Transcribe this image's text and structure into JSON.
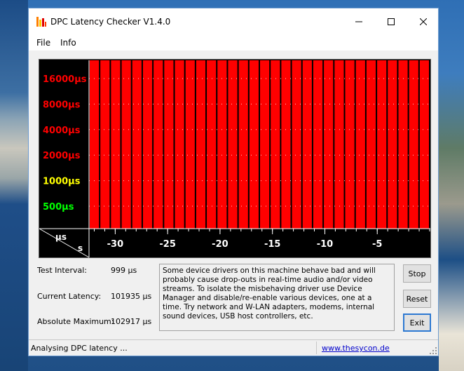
{
  "window": {
    "title": "DPC Latency Checker V1.4.0",
    "icon": "bar-chart-app-icon",
    "controls": {
      "minimize": "minimize-icon",
      "maximize": "maximize-icon",
      "close": "close-icon"
    }
  },
  "menu": {
    "file": "File",
    "info": "Info"
  },
  "chart_data": {
    "type": "bar",
    "y_axis_labels": [
      {
        "text": "16000µs",
        "value": 16000,
        "color": "#ff0000"
      },
      {
        "text": "8000µs",
        "value": 8000,
        "color": "#ff0000"
      },
      {
        "text": "4000µs",
        "value": 4000,
        "color": "#ff0000"
      },
      {
        "text": "2000µs",
        "value": 2000,
        "color": "#ff0000"
      },
      {
        "text": "1000µs",
        "value": 1000,
        "color": "#ffff00"
      },
      {
        "text": "500µs",
        "value": 500,
        "color": "#00ff00"
      }
    ],
    "y_unit": "µs",
    "x_unit": "s",
    "x_ticks": [
      -30,
      -25,
      -20,
      -15,
      -10,
      -5
    ],
    "x_range": [
      -32.5,
      0
    ],
    "bar_count": 32,
    "bar_color": "#ff0000",
    "background": "#000000",
    "y_scale": "log",
    "note_bars_clipped_at_top": true
  },
  "stats": {
    "test_interval_label": "Test Interval:",
    "test_interval_value": "999 µs",
    "current_latency_label": "Current Latency:",
    "current_latency_value": "101935 µs",
    "absolute_max_label": "Absolute Maximum:",
    "absolute_max_value": "102917 µs"
  },
  "description": "Some device drivers on this machine behave bad and will probably cause drop-outs in real-time audio and/or video streams. To isolate the misbehaving driver use Device Manager and disable/re-enable various devices, one at a time. Try network and W-LAN adapters, modems, internal sound devices, USB host controllers, etc.",
  "buttons": {
    "stop": "Stop",
    "reset": "Reset",
    "exit": "Exit"
  },
  "status": {
    "text": "Analysing DPC latency ...",
    "link": "www.thesycon.de"
  }
}
